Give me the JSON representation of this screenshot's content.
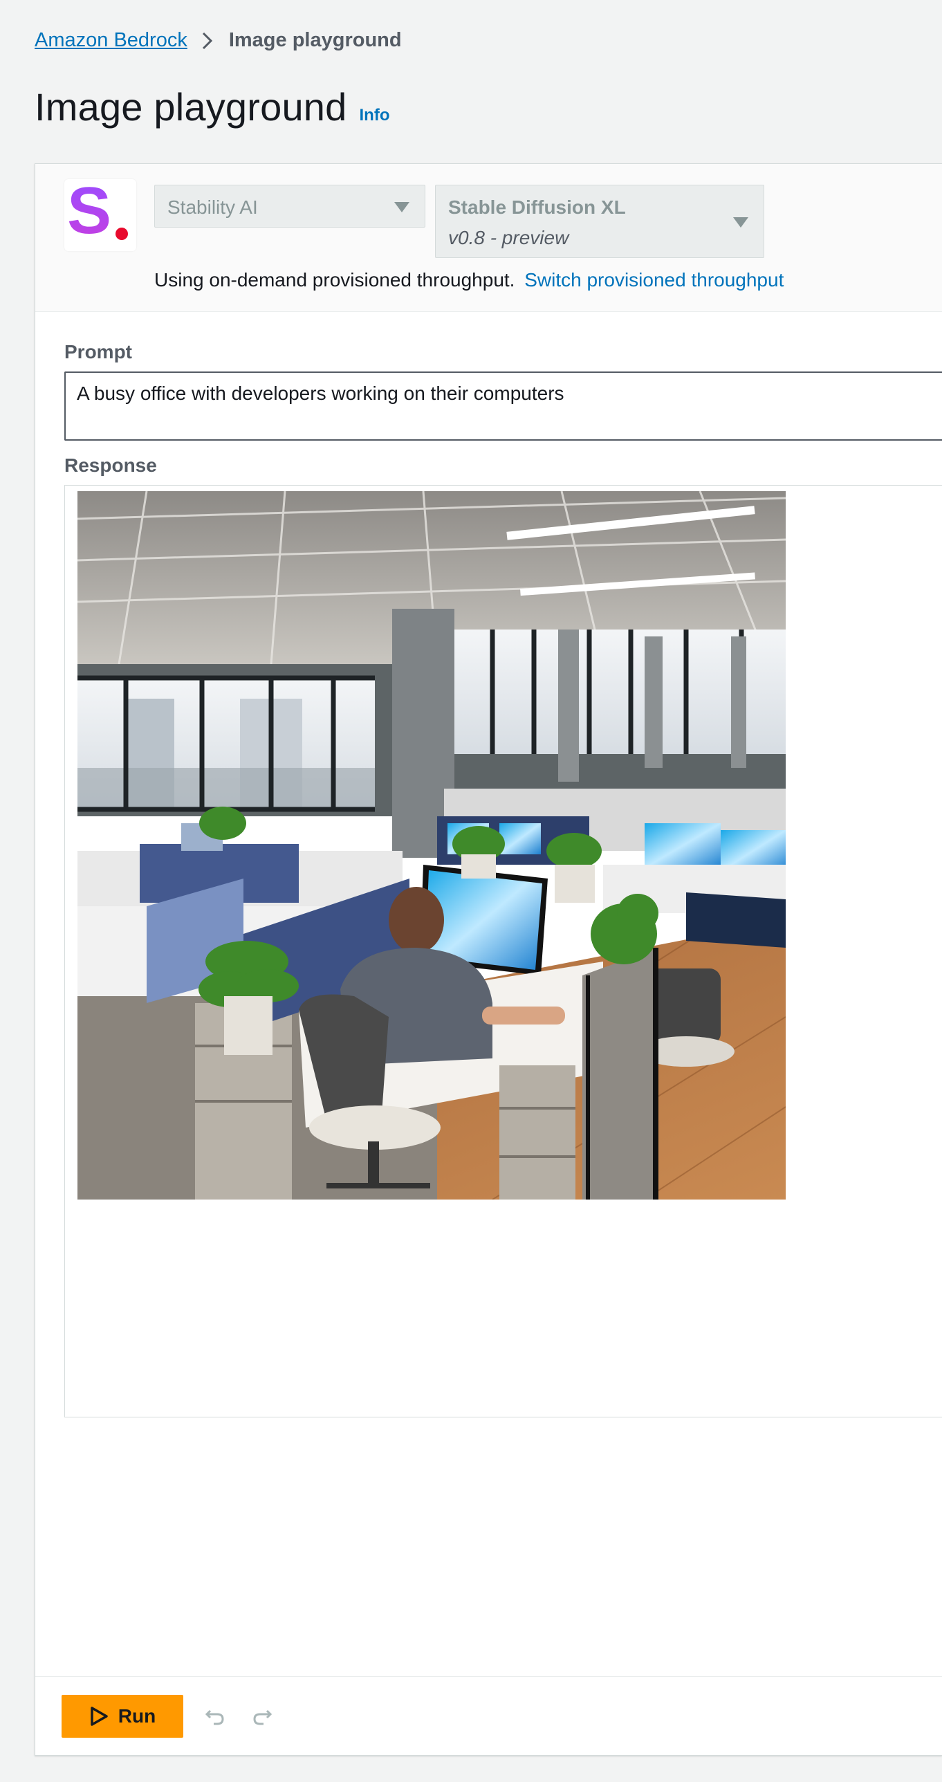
{
  "breadcrumb": {
    "parent": "Amazon Bedrock",
    "current": "Image playground"
  },
  "header": {
    "title": "Image playground",
    "info": "Info"
  },
  "model_selector": {
    "provider_logo_icon": "stability-ai-logo",
    "provider": "Stability AI",
    "model_name": "Stable Diffusion XL",
    "model_version": "v0.8 - preview",
    "throughput_text": "Using on-demand provisioned throughput.",
    "throughput_link": "Switch provisioned throughput"
  },
  "prompt": {
    "label": "Prompt",
    "value": "A busy office with developers working on their computers"
  },
  "response": {
    "label": "Response",
    "image_icon": "generated-office-image"
  },
  "footer": {
    "run_label": "Run",
    "undo_icon": "undo-icon",
    "redo_icon": "redo-icon"
  },
  "colors": {
    "link": "#0073bb",
    "primary_button": "#ff9900",
    "page_background": "#f2f3f3"
  }
}
